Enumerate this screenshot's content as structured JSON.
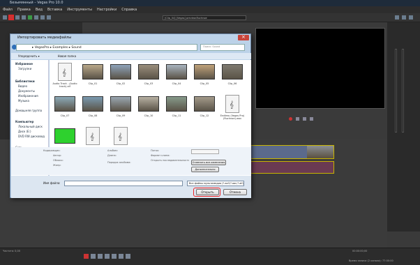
{
  "app": {
    "title": "Безымянный – Vegas Pro 10.0",
    "menu": [
      "Файл",
      "Правка",
      "Вид",
      "Вставка",
      "Инструменты",
      "Настройки",
      "Справка"
    ],
    "preview_dropdown": "[Clip_04] [Vegas] preview.Ruchnoe",
    "timecode": "00:00:00;00",
    "status_left": "Частота: 0,00",
    "status_right": "Время записи (2 канала): 77:00:00"
  },
  "dialog": {
    "title": "Импортировать медиафайлы",
    "address_path": "▸ VegasPro ▸ Examples ▸ Sound",
    "search_placeholder": "Поиск: Sound",
    "cmd": {
      "organize": "Упорядочить ▾",
      "new_folder": "Новая папка"
    },
    "nav": {
      "favorites": "Избранное",
      "downloads": "Загрузки",
      "libraries": "Библиотеки",
      "video": "Видео",
      "documents": "Документы",
      "images": "Изображения",
      "music": "Музыка",
      "homegroup": "Домашняя группа",
      "computer": "Компьютер",
      "local_disk": "Локальный диск",
      "disk_e": "Диск (E:)",
      "dvd": "DVD RW дисковод",
      "network": "Сеть"
    },
    "files": [
      {
        "name": "Audio Track - (Audio track).aif",
        "kind": "audio"
      },
      {
        "name": "Clip_01",
        "kind": "video"
      },
      {
        "name": "Clip_02",
        "kind": "video"
      },
      {
        "name": "Clip_03",
        "kind": "video"
      },
      {
        "name": "Clip_04",
        "kind": "video"
      },
      {
        "name": "Clip_05",
        "kind": "video"
      },
      {
        "name": "Clip_06",
        "kind": "video"
      },
      {
        "name": "Clip_07",
        "kind": "video"
      },
      {
        "name": "Clip_08",
        "kind": "video"
      },
      {
        "name": "Clip_09",
        "kind": "video"
      },
      {
        "name": "Clip_10",
        "kind": "video"
      },
      {
        "name": "Clip_11",
        "kind": "video"
      },
      {
        "name": "Clip_12",
        "kind": "video"
      },
      {
        "name": "Endless (Vegas Pro) (Ruchnoe).wav",
        "kind": "audio"
      },
      {
        "name": "",
        "kind": "green"
      },
      {
        "name": "",
        "kind": "audio"
      },
      {
        "name": "",
        "kind": "audio"
      }
    ],
    "props": {
      "encoder": "Кодировщик:",
      "author": "Автор:",
      "cloud": "Облако:",
      "genre": "Жанр:",
      "album": "Альбом:",
      "length": "Длина:",
      "album_order": "Порядок альбома:",
      "stream": "Поток:",
      "clip_format": "Формат клипа:",
      "image_sequence": "Открыть последовательность изображений",
      "open_options": "Открыть ещё:"
    },
    "filename_label": "Имя файла:",
    "filename_value": "",
    "filetype": "Все файлы мультимедиа (*.aa3;*.aac;*.aif)",
    "btn_open": "Открыть",
    "btn_cancel": "Отмена",
    "btn_small_1": "Отменить все изменения",
    "btn_small_2": "Дополнительно"
  }
}
